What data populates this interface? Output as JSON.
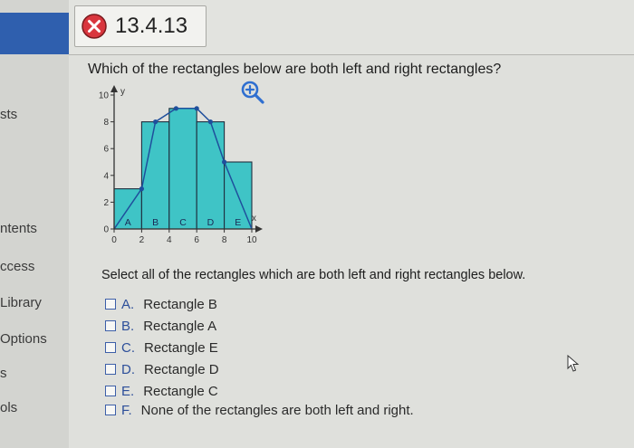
{
  "sidebar": {
    "items": [
      {
        "label": "sts"
      },
      {
        "label": "ntents"
      },
      {
        "label": "ccess"
      },
      {
        "label": "Library"
      },
      {
        "label": "Options"
      },
      {
        "label": "s"
      },
      {
        "label": "ols"
      }
    ]
  },
  "header": {
    "question_id": "13.4.13",
    "status_icon": "incorrect-icon",
    "status_color": "#d9363e"
  },
  "question": {
    "text": "Which of the rectangles below are both left and right rectangles?"
  },
  "chart_data": {
    "type": "bar",
    "xlabel": "x",
    "ylabel": "y",
    "xlim": [
      0,
      10
    ],
    "ylim": [
      0,
      10
    ],
    "x_ticks": [
      "0",
      "2",
      "4",
      "6",
      "8",
      "10"
    ],
    "y_ticks": [
      "0",
      "2",
      "4",
      "6",
      "8",
      "10"
    ],
    "categories": [
      "A",
      "B",
      "C",
      "D",
      "E"
    ],
    "rect_x": [
      [
        0,
        2
      ],
      [
        2,
        4
      ],
      [
        4,
        6
      ],
      [
        6,
        8
      ],
      [
        8,
        10
      ]
    ],
    "values": [
      3,
      8,
      9,
      8,
      5
    ],
    "curve": [
      [
        0,
        0
      ],
      [
        2,
        3
      ],
      [
        3,
        8
      ],
      [
        4.5,
        9
      ],
      [
        6,
        9
      ],
      [
        7,
        8
      ],
      [
        8,
        5
      ],
      [
        10,
        0
      ]
    ],
    "marked_points": [
      [
        2,
        3
      ],
      [
        3,
        8
      ],
      [
        4.5,
        9
      ],
      [
        6,
        9
      ],
      [
        7,
        8
      ],
      [
        8,
        5
      ]
    ],
    "bar_color": "#3fc4c6",
    "curve_color": "#1f4f9c"
  },
  "zoom_icon": "zoom-in-icon",
  "prompt": "Select all of the rectangles which are both left and right rectangles below.",
  "options": [
    {
      "letter": "A.",
      "label": "Rectangle B"
    },
    {
      "letter": "B.",
      "label": "Rectangle A"
    },
    {
      "letter": "C.",
      "label": "Rectangle E"
    },
    {
      "letter": "D.",
      "label": "Rectangle D"
    },
    {
      "letter": "E.",
      "label": "Rectangle C"
    },
    {
      "letter": "F.",
      "label": "None of the rectangles are both left and right."
    }
  ]
}
